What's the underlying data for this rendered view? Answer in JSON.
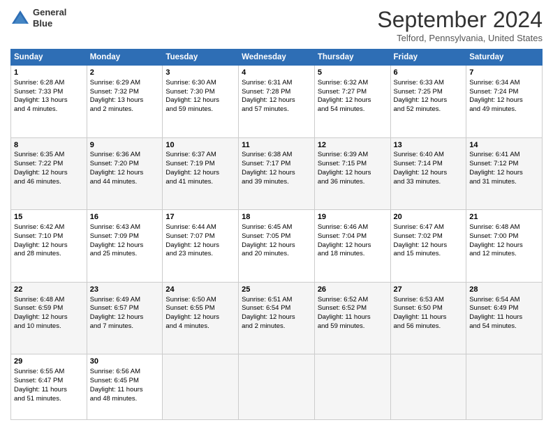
{
  "header": {
    "logo_line1": "General",
    "logo_line2": "Blue",
    "month": "September 2024",
    "location": "Telford, Pennsylvania, United States"
  },
  "days_of_week": [
    "Sunday",
    "Monday",
    "Tuesday",
    "Wednesday",
    "Thursday",
    "Friday",
    "Saturday"
  ],
  "weeks": [
    [
      {
        "day": 1,
        "lines": [
          "Sunrise: 6:28 AM",
          "Sunset: 7:33 PM",
          "Daylight: 13 hours",
          "and 4 minutes."
        ]
      },
      {
        "day": 2,
        "lines": [
          "Sunrise: 6:29 AM",
          "Sunset: 7:32 PM",
          "Daylight: 13 hours",
          "and 2 minutes."
        ]
      },
      {
        "day": 3,
        "lines": [
          "Sunrise: 6:30 AM",
          "Sunset: 7:30 PM",
          "Daylight: 12 hours",
          "and 59 minutes."
        ]
      },
      {
        "day": 4,
        "lines": [
          "Sunrise: 6:31 AM",
          "Sunset: 7:28 PM",
          "Daylight: 12 hours",
          "and 57 minutes."
        ]
      },
      {
        "day": 5,
        "lines": [
          "Sunrise: 6:32 AM",
          "Sunset: 7:27 PM",
          "Daylight: 12 hours",
          "and 54 minutes."
        ]
      },
      {
        "day": 6,
        "lines": [
          "Sunrise: 6:33 AM",
          "Sunset: 7:25 PM",
          "Daylight: 12 hours",
          "and 52 minutes."
        ]
      },
      {
        "day": 7,
        "lines": [
          "Sunrise: 6:34 AM",
          "Sunset: 7:24 PM",
          "Daylight: 12 hours",
          "and 49 minutes."
        ]
      }
    ],
    [
      {
        "day": 8,
        "lines": [
          "Sunrise: 6:35 AM",
          "Sunset: 7:22 PM",
          "Daylight: 12 hours",
          "and 46 minutes."
        ]
      },
      {
        "day": 9,
        "lines": [
          "Sunrise: 6:36 AM",
          "Sunset: 7:20 PM",
          "Daylight: 12 hours",
          "and 44 minutes."
        ]
      },
      {
        "day": 10,
        "lines": [
          "Sunrise: 6:37 AM",
          "Sunset: 7:19 PM",
          "Daylight: 12 hours",
          "and 41 minutes."
        ]
      },
      {
        "day": 11,
        "lines": [
          "Sunrise: 6:38 AM",
          "Sunset: 7:17 PM",
          "Daylight: 12 hours",
          "and 39 minutes."
        ]
      },
      {
        "day": 12,
        "lines": [
          "Sunrise: 6:39 AM",
          "Sunset: 7:15 PM",
          "Daylight: 12 hours",
          "and 36 minutes."
        ]
      },
      {
        "day": 13,
        "lines": [
          "Sunrise: 6:40 AM",
          "Sunset: 7:14 PM",
          "Daylight: 12 hours",
          "and 33 minutes."
        ]
      },
      {
        "day": 14,
        "lines": [
          "Sunrise: 6:41 AM",
          "Sunset: 7:12 PM",
          "Daylight: 12 hours",
          "and 31 minutes."
        ]
      }
    ],
    [
      {
        "day": 15,
        "lines": [
          "Sunrise: 6:42 AM",
          "Sunset: 7:10 PM",
          "Daylight: 12 hours",
          "and 28 minutes."
        ]
      },
      {
        "day": 16,
        "lines": [
          "Sunrise: 6:43 AM",
          "Sunset: 7:09 PM",
          "Daylight: 12 hours",
          "and 25 minutes."
        ]
      },
      {
        "day": 17,
        "lines": [
          "Sunrise: 6:44 AM",
          "Sunset: 7:07 PM",
          "Daylight: 12 hours",
          "and 23 minutes."
        ]
      },
      {
        "day": 18,
        "lines": [
          "Sunrise: 6:45 AM",
          "Sunset: 7:05 PM",
          "Daylight: 12 hours",
          "and 20 minutes."
        ]
      },
      {
        "day": 19,
        "lines": [
          "Sunrise: 6:46 AM",
          "Sunset: 7:04 PM",
          "Daylight: 12 hours",
          "and 18 minutes."
        ]
      },
      {
        "day": 20,
        "lines": [
          "Sunrise: 6:47 AM",
          "Sunset: 7:02 PM",
          "Daylight: 12 hours",
          "and 15 minutes."
        ]
      },
      {
        "day": 21,
        "lines": [
          "Sunrise: 6:48 AM",
          "Sunset: 7:00 PM",
          "Daylight: 12 hours",
          "and 12 minutes."
        ]
      }
    ],
    [
      {
        "day": 22,
        "lines": [
          "Sunrise: 6:48 AM",
          "Sunset: 6:59 PM",
          "Daylight: 12 hours",
          "and 10 minutes."
        ]
      },
      {
        "day": 23,
        "lines": [
          "Sunrise: 6:49 AM",
          "Sunset: 6:57 PM",
          "Daylight: 12 hours",
          "and 7 minutes."
        ]
      },
      {
        "day": 24,
        "lines": [
          "Sunrise: 6:50 AM",
          "Sunset: 6:55 PM",
          "Daylight: 12 hours",
          "and 4 minutes."
        ]
      },
      {
        "day": 25,
        "lines": [
          "Sunrise: 6:51 AM",
          "Sunset: 6:54 PM",
          "Daylight: 12 hours",
          "and 2 minutes."
        ]
      },
      {
        "day": 26,
        "lines": [
          "Sunrise: 6:52 AM",
          "Sunset: 6:52 PM",
          "Daylight: 11 hours",
          "and 59 minutes."
        ]
      },
      {
        "day": 27,
        "lines": [
          "Sunrise: 6:53 AM",
          "Sunset: 6:50 PM",
          "Daylight: 11 hours",
          "and 56 minutes."
        ]
      },
      {
        "day": 28,
        "lines": [
          "Sunrise: 6:54 AM",
          "Sunset: 6:49 PM",
          "Daylight: 11 hours",
          "and 54 minutes."
        ]
      }
    ],
    [
      {
        "day": 29,
        "lines": [
          "Sunrise: 6:55 AM",
          "Sunset: 6:47 PM",
          "Daylight: 11 hours",
          "and 51 minutes."
        ]
      },
      {
        "day": 30,
        "lines": [
          "Sunrise: 6:56 AM",
          "Sunset: 6:45 PM",
          "Daylight: 11 hours",
          "and 48 minutes."
        ]
      },
      null,
      null,
      null,
      null,
      null
    ]
  ]
}
